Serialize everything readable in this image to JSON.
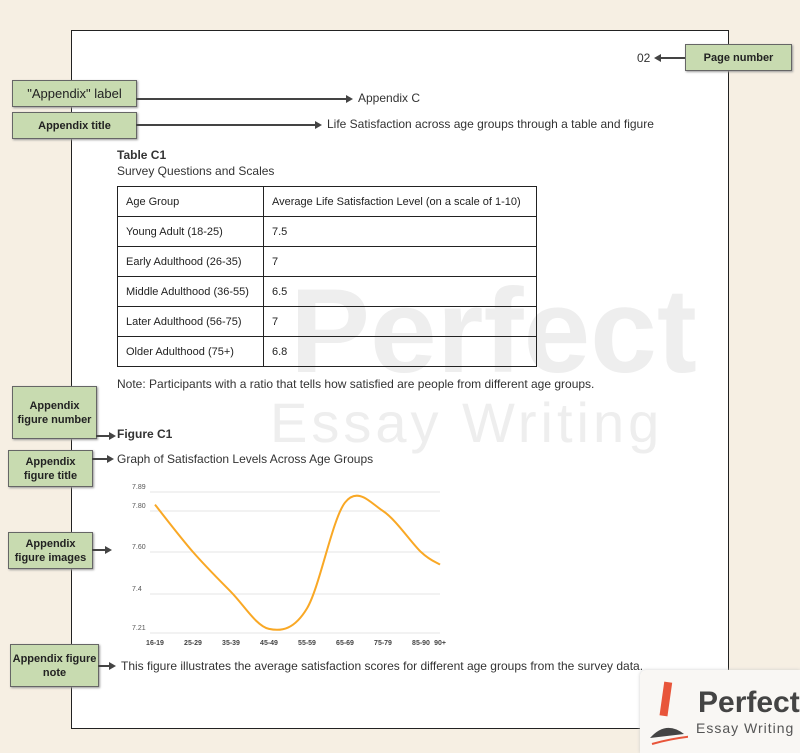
{
  "page_number": "02",
  "appendix_label": "Appendix C",
  "appendix_title": "Life Satisfaction across age groups through a table and figure",
  "table": {
    "number": "Table C1",
    "title": "Survey Questions and Scales",
    "headers": [
      "Age Group",
      "Average Life Satisfaction Level (on a scale of 1-10)"
    ],
    "rows": [
      [
        "Young Adult (18-25)",
        "7.5"
      ],
      [
        "Early Adulthood (26-35)",
        "7"
      ],
      [
        "Middle Adulthood (36-55)",
        "6.5"
      ],
      [
        "Later Adulthood (56-75)",
        "7"
      ],
      [
        "Older Adulthood (75+)",
        "6.8"
      ]
    ],
    "note": "Note: Participants with a ratio that tells how satisfied are people from different age groups."
  },
  "figure": {
    "number": "Figure C1",
    "title": "Graph of Satisfaction Levels Across Age Groups",
    "note": "This figure illustrates the average satisfaction scores for different age groups from the survey data."
  },
  "annotations": {
    "page_number": "Page number",
    "appendix_label": "\"Appendix\" label",
    "appendix_title": "Appendix title",
    "figure_number": "Appendix figure number",
    "figure_title": "Appendix figure title",
    "figure_images": "Appendix figure images",
    "figure_note": "Appendix figure note"
  },
  "watermark": {
    "line1": "Perfect",
    "line2": "Essay Writing"
  },
  "logo": {
    "line1": "Perfect",
    "line2": "Essay Writing"
  },
  "colors": {
    "line": "#f9a825",
    "annotation_bg": "#c8dbb0",
    "background": "#f6efe3"
  },
  "chart_data": {
    "type": "line",
    "categories": [
      "16-19",
      "25-29",
      "35-39",
      "45-49",
      "55-59",
      "65-69",
      "75-79",
      "85-90",
      "90+"
    ],
    "values": [
      7.83,
      7.6,
      7.41,
      7.23,
      7.33,
      7.84,
      7.8,
      7.6,
      7.54
    ],
    "yticks": [
      7.21,
      7.4,
      7.6,
      7.8,
      7.89
    ],
    "ytick_labels": [
      "7.21",
      "7.4",
      "7.60",
      "7.80",
      "7.89"
    ],
    "ylim": [
      7.21,
      7.89
    ],
    "grid": true,
    "title": "",
    "xlabel": "",
    "ylabel": ""
  }
}
